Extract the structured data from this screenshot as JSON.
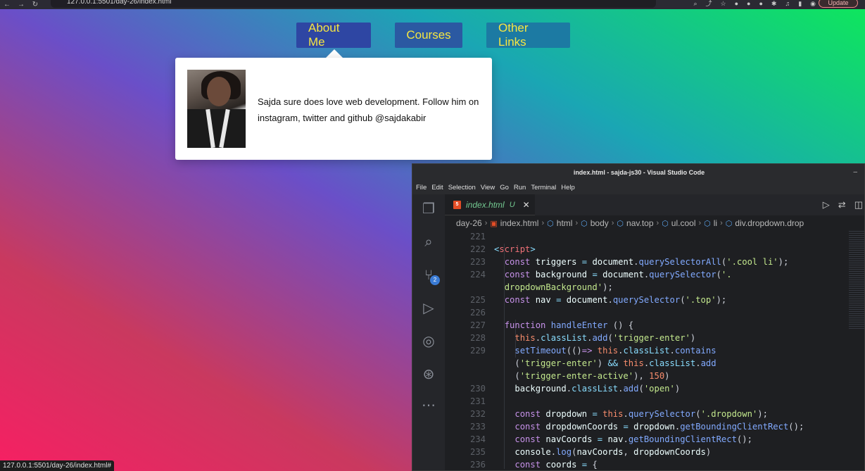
{
  "browser": {
    "url": "127.0.0.1:5501/day-26/index.html",
    "update_label": "Update"
  },
  "nav": {
    "items": [
      {
        "label": "About Me"
      },
      {
        "label": "Courses"
      },
      {
        "label": "Other Links"
      }
    ]
  },
  "dropdown": {
    "bio": "Sajda sure does love web development. Follow him on instagram, twitter and github @sajdakabir"
  },
  "status_bar": {
    "link": "127.0.0.1:5501/day-26/index.html#"
  },
  "vscode": {
    "title": "index.html - sajda-js30 - Visual Studio Code",
    "menu": [
      "File",
      "Edit",
      "Selection",
      "View",
      "Go",
      "Run",
      "Terminal",
      "Help"
    ],
    "scm_badge": "2",
    "tab": {
      "label": "index.html",
      "status": "U"
    },
    "breadcrumb": [
      "day-26",
      "index.html",
      "html",
      "body",
      "nav.top",
      "ul.cool",
      "li",
      "div.dropdown.drop"
    ],
    "line_numbers": [
      "221",
      "222",
      "223",
      "224",
      "",
      "225",
      "226",
      "227",
      "228",
      "229",
      "",
      "",
      "230",
      "231",
      "232",
      "233",
      "234",
      "235",
      "236"
    ]
  }
}
